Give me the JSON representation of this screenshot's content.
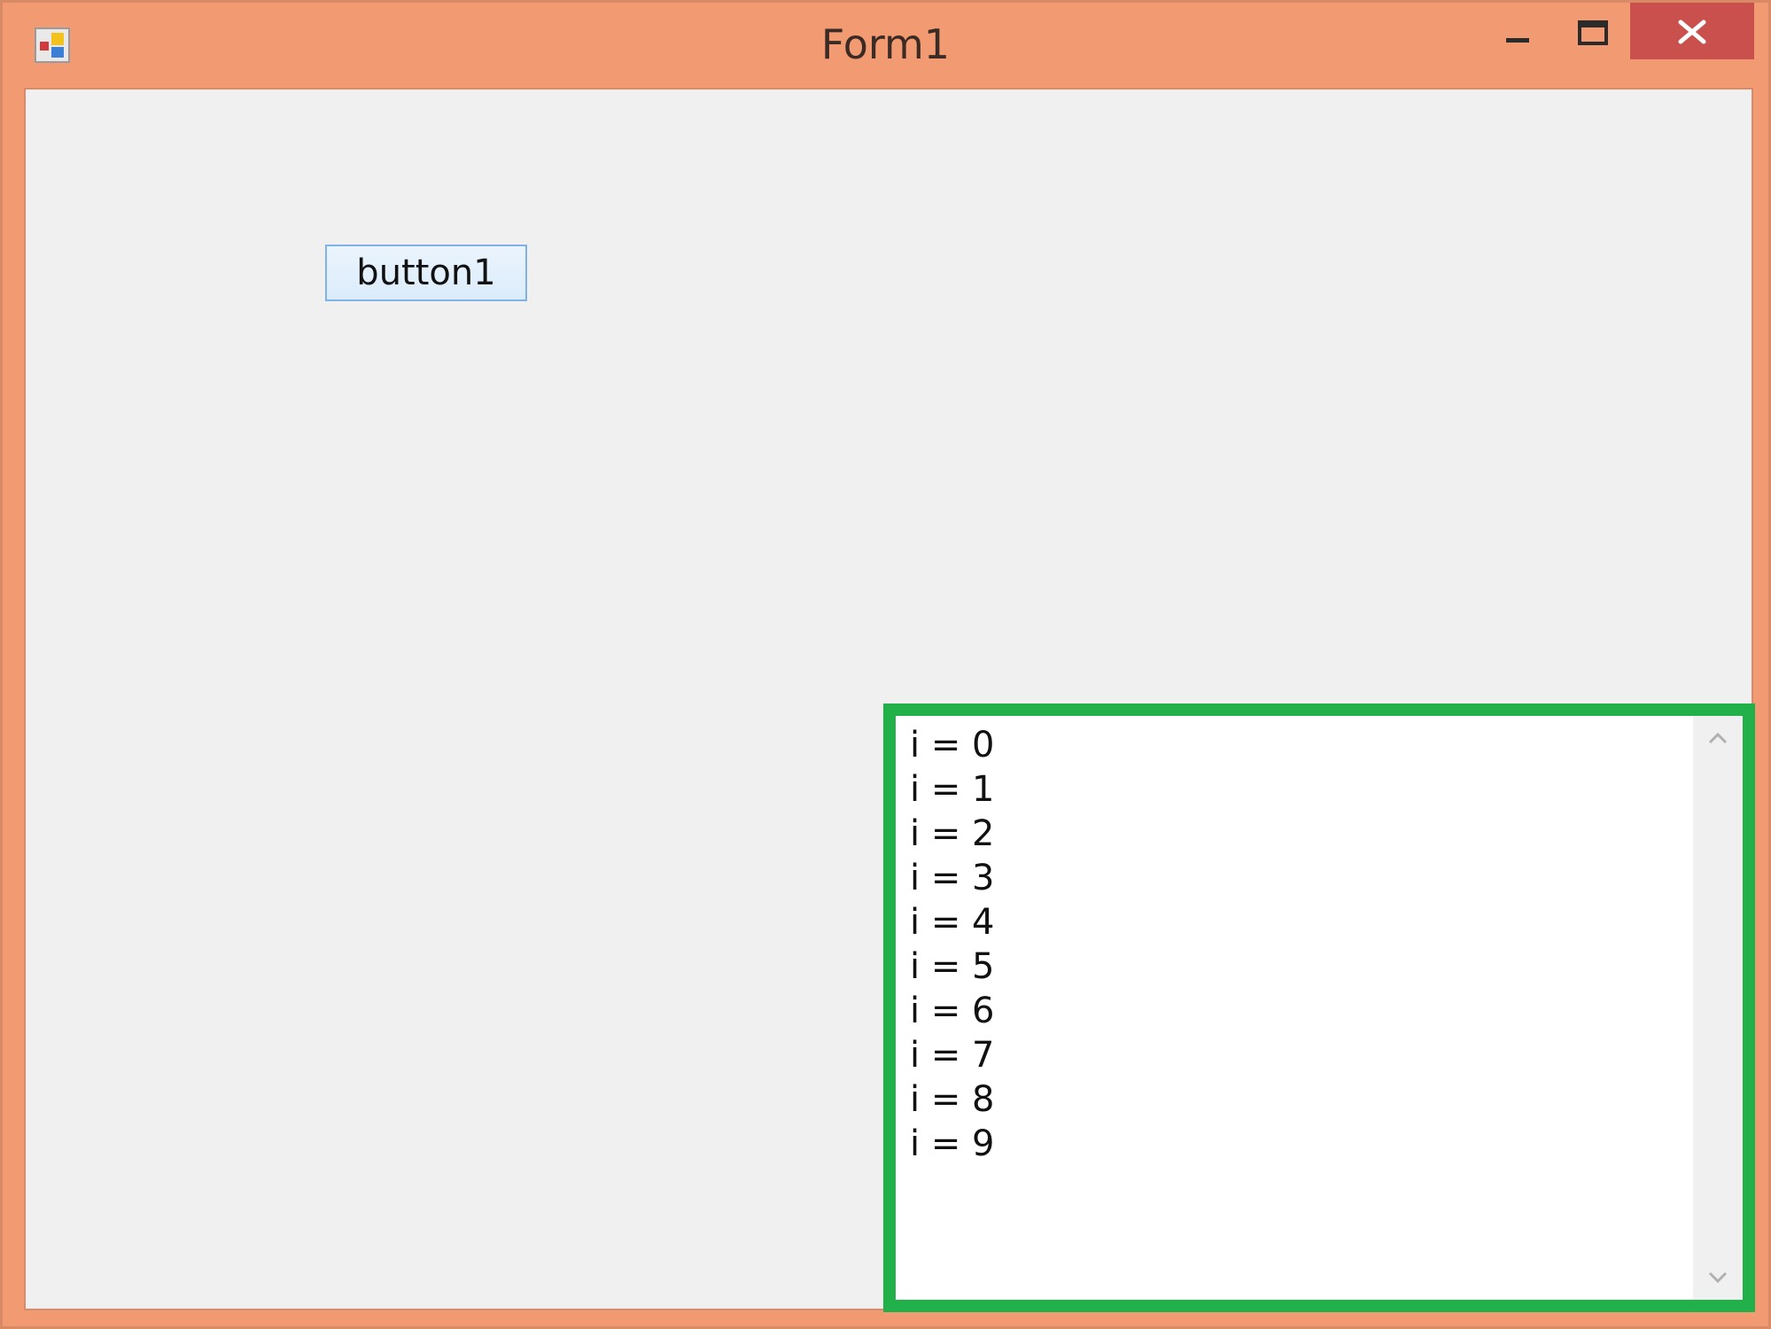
{
  "window": {
    "title": "Form1",
    "icon": "form-app-icon",
    "controls": {
      "minimize_icon": "minimize-icon",
      "maximize_icon": "maximize-icon",
      "close_icon": "close-icon"
    },
    "colors": {
      "frame": "#f29b73",
      "close": "#c9504c",
      "client": "#f0f0f0",
      "highlight_border": "#22b04a"
    }
  },
  "form": {
    "button1_label": "button1",
    "output_lines": [
      "i = 0",
      "i = 1",
      "i = 2",
      "i = 3",
      "i = 4",
      "i = 5",
      "i = 6",
      "i = 7",
      "i = 8",
      "i = 9"
    ]
  }
}
